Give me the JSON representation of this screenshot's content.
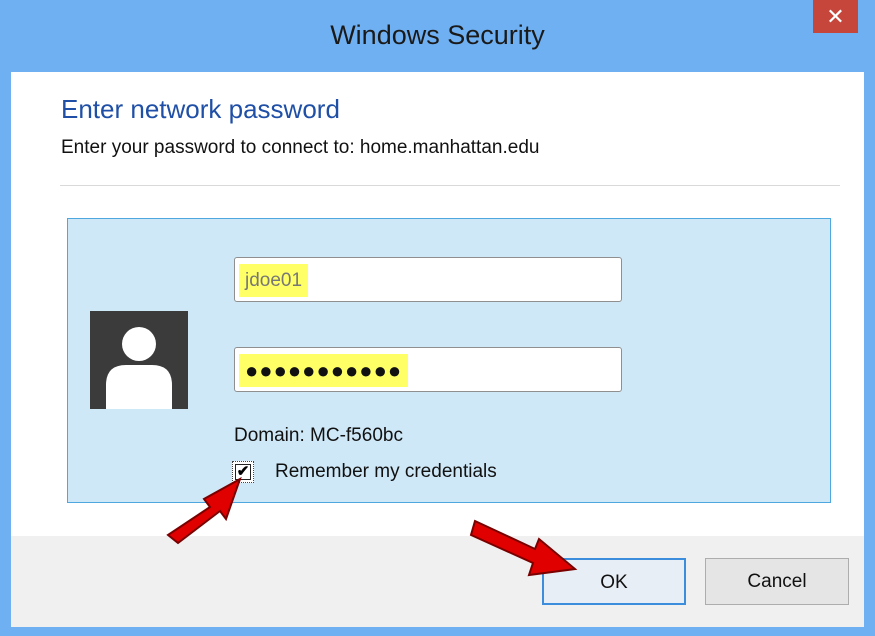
{
  "window": {
    "title": "Windows Security",
    "close_glyph": "✕"
  },
  "dialog": {
    "heading": "Enter network password",
    "subheading": "Enter your password to connect to: home.manhattan.edu"
  },
  "credentials": {
    "username_value": "jdoe01",
    "password_value": "●●●●●●●●●●●",
    "domain_text": "Domain: MC-f560bc",
    "remember_label": "Remember my credentials",
    "remember_checked": true,
    "check_glyph": "✔"
  },
  "buttons": {
    "ok_label": "OK",
    "cancel_label": "Cancel"
  },
  "icons": {
    "avatar": "user-avatar-icon",
    "annotation": "red-arrow-icon"
  },
  "colors": {
    "frame": "#6fb0f2",
    "heading": "#1f4fa6",
    "tile": "#cfe8f7",
    "highlight": "#ffff66",
    "close": "#c7463c",
    "arrow": "#e00000"
  }
}
